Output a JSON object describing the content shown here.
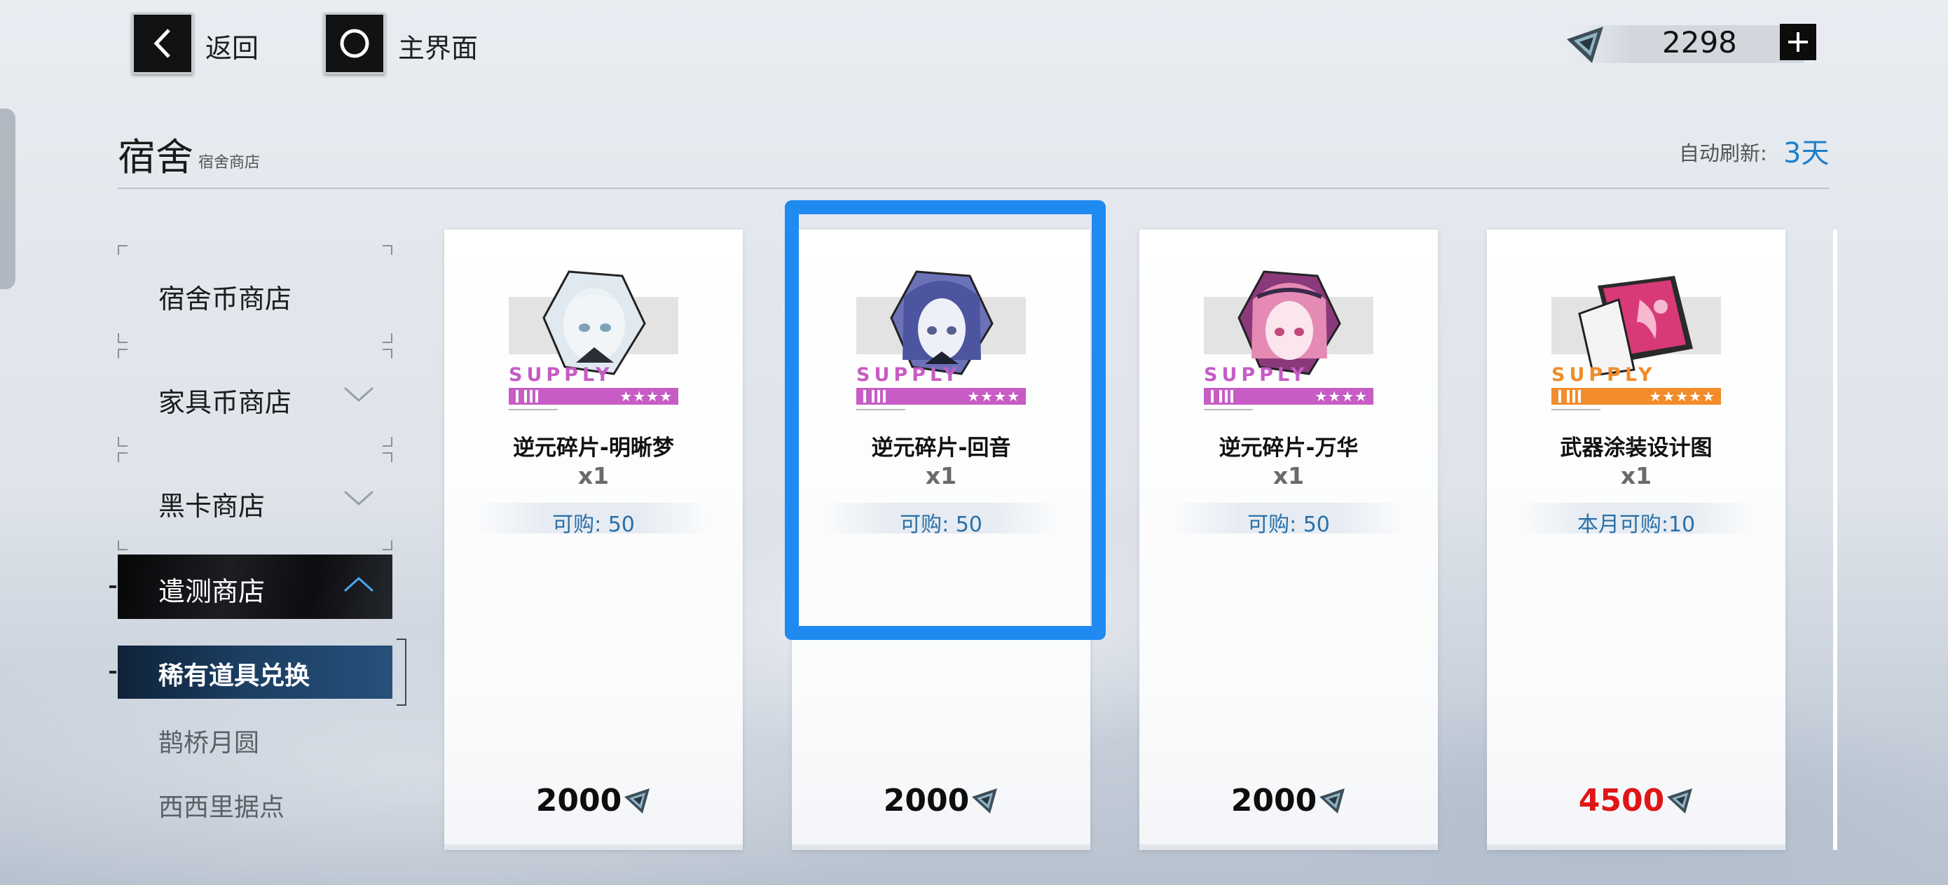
{
  "topbar": {
    "back_label": "返回",
    "home_label": "主界面",
    "currency_value": "2298",
    "back_icon": "chevron-left-icon",
    "home_icon": "circle-icon",
    "currency_icon": "crystal-triangle-icon",
    "plus_icon": "plus-icon"
  },
  "header": {
    "title": "宿舍",
    "subtitle": "宿舍商店",
    "refresh_label": "自动刷新:",
    "refresh_value": "3天"
  },
  "sidebar": {
    "items": [
      {
        "label": "宿舍币商店"
      },
      {
        "label": "家具币商店"
      },
      {
        "label": "黑卡商店"
      }
    ],
    "active": {
      "label": "遣测商店"
    },
    "sub_active": {
      "label": "稀有道具兑换"
    },
    "sub_items": [
      {
        "label": "鹊桥月圆"
      },
      {
        "label": "西西里据点"
      }
    ]
  },
  "cards": [
    {
      "supply": "SUPPLY",
      "stars": "★★★★",
      "name": "逆元碎片-明晰梦",
      "qty": "x1",
      "limit": "可购: 50",
      "price": "2000"
    },
    {
      "supply": "SUPPLY",
      "stars": "★★★★",
      "name": "逆元碎片-回音",
      "qty": "x1",
      "limit": "可购: 50",
      "price": "2000"
    },
    {
      "supply": "SUPPLY",
      "stars": "★★★★",
      "name": "逆元碎片-万华",
      "qty": "x1",
      "limit": "可购: 50",
      "price": "2000"
    },
    {
      "supply": "SUPPLY",
      "stars": "★★★★★",
      "name": "武器涂装设计图",
      "qty": "x1",
      "limit": "本月可购:10",
      "price": "4500"
    }
  ],
  "colors": {
    "accent_blue": "#1f8af0",
    "rarity_purple": "#c65cc4",
    "rarity_orange": "#f28c2a",
    "price_red": "#e01616",
    "limit_blue": "#2a6fa8"
  }
}
